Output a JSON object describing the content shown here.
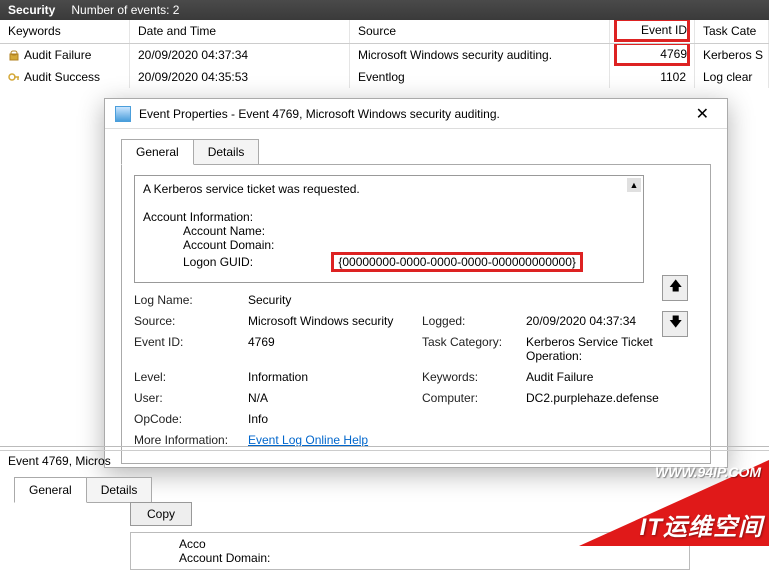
{
  "topbar": {
    "title": "Security",
    "count_label": "Number of events: 2"
  },
  "columns": {
    "keywords": "Keywords",
    "datetime": "Date and Time",
    "source": "Source",
    "eventid": "Event ID",
    "taskcat": "Task Cate"
  },
  "rows": [
    {
      "kw": "Audit Failure",
      "dt": "20/09/2020 04:37:34",
      "src": "Microsoft Windows security auditing.",
      "eid": "4769",
      "tc": "Kerberos S"
    },
    {
      "kw": "Audit Success",
      "dt": "20/09/2020 04:35:53",
      "src": "Eventlog",
      "eid": "1102",
      "tc": "Log clear"
    }
  ],
  "dialog": {
    "title": "Event Properties - Event 4769, Microsoft Windows security auditing.",
    "tabs": {
      "general": "General",
      "details": "Details"
    },
    "desc_line": "A Kerberos service ticket was requested.",
    "acct_header": "Account Information:",
    "acct_name_lbl": "Account Name:",
    "acct_domain_lbl": "Account Domain:",
    "guid_lbl": "Logon GUID:",
    "guid_val": "{00000000-0000-0000-0000-000000000000}",
    "fields": {
      "logname_l": "Log Name:",
      "logname_v": "Security",
      "source_l": "Source:",
      "source_v": "Microsoft Windows security",
      "logged_l": "Logged:",
      "logged_v": "20/09/2020 04:37:34",
      "eventid_l": "Event ID:",
      "eventid_v": "4769",
      "taskcat_l": "Task Category:",
      "taskcat_v": "Kerberos Service Ticket Operation:",
      "level_l": "Level:",
      "level_v": "Information",
      "keywords_l": "Keywords:",
      "keywords_v": "Audit Failure",
      "user_l": "User:",
      "user_v": "N/A",
      "computer_l": "Computer:",
      "computer_v": "DC2.purplehaze.defense",
      "opcode_l": "OpCode:",
      "opcode_v": "Info",
      "moreinfo_l": "More Information:",
      "moreinfo_link": "Event Log Online Help"
    }
  },
  "bottom": {
    "title": "Event 4769, Micros",
    "copy": "Copy",
    "acct_line1": "Acco",
    "acct_line2": "Account Domain:"
  },
  "banner": {
    "url": "WWW.94IP.COM",
    "cn": "IT运维空间"
  }
}
